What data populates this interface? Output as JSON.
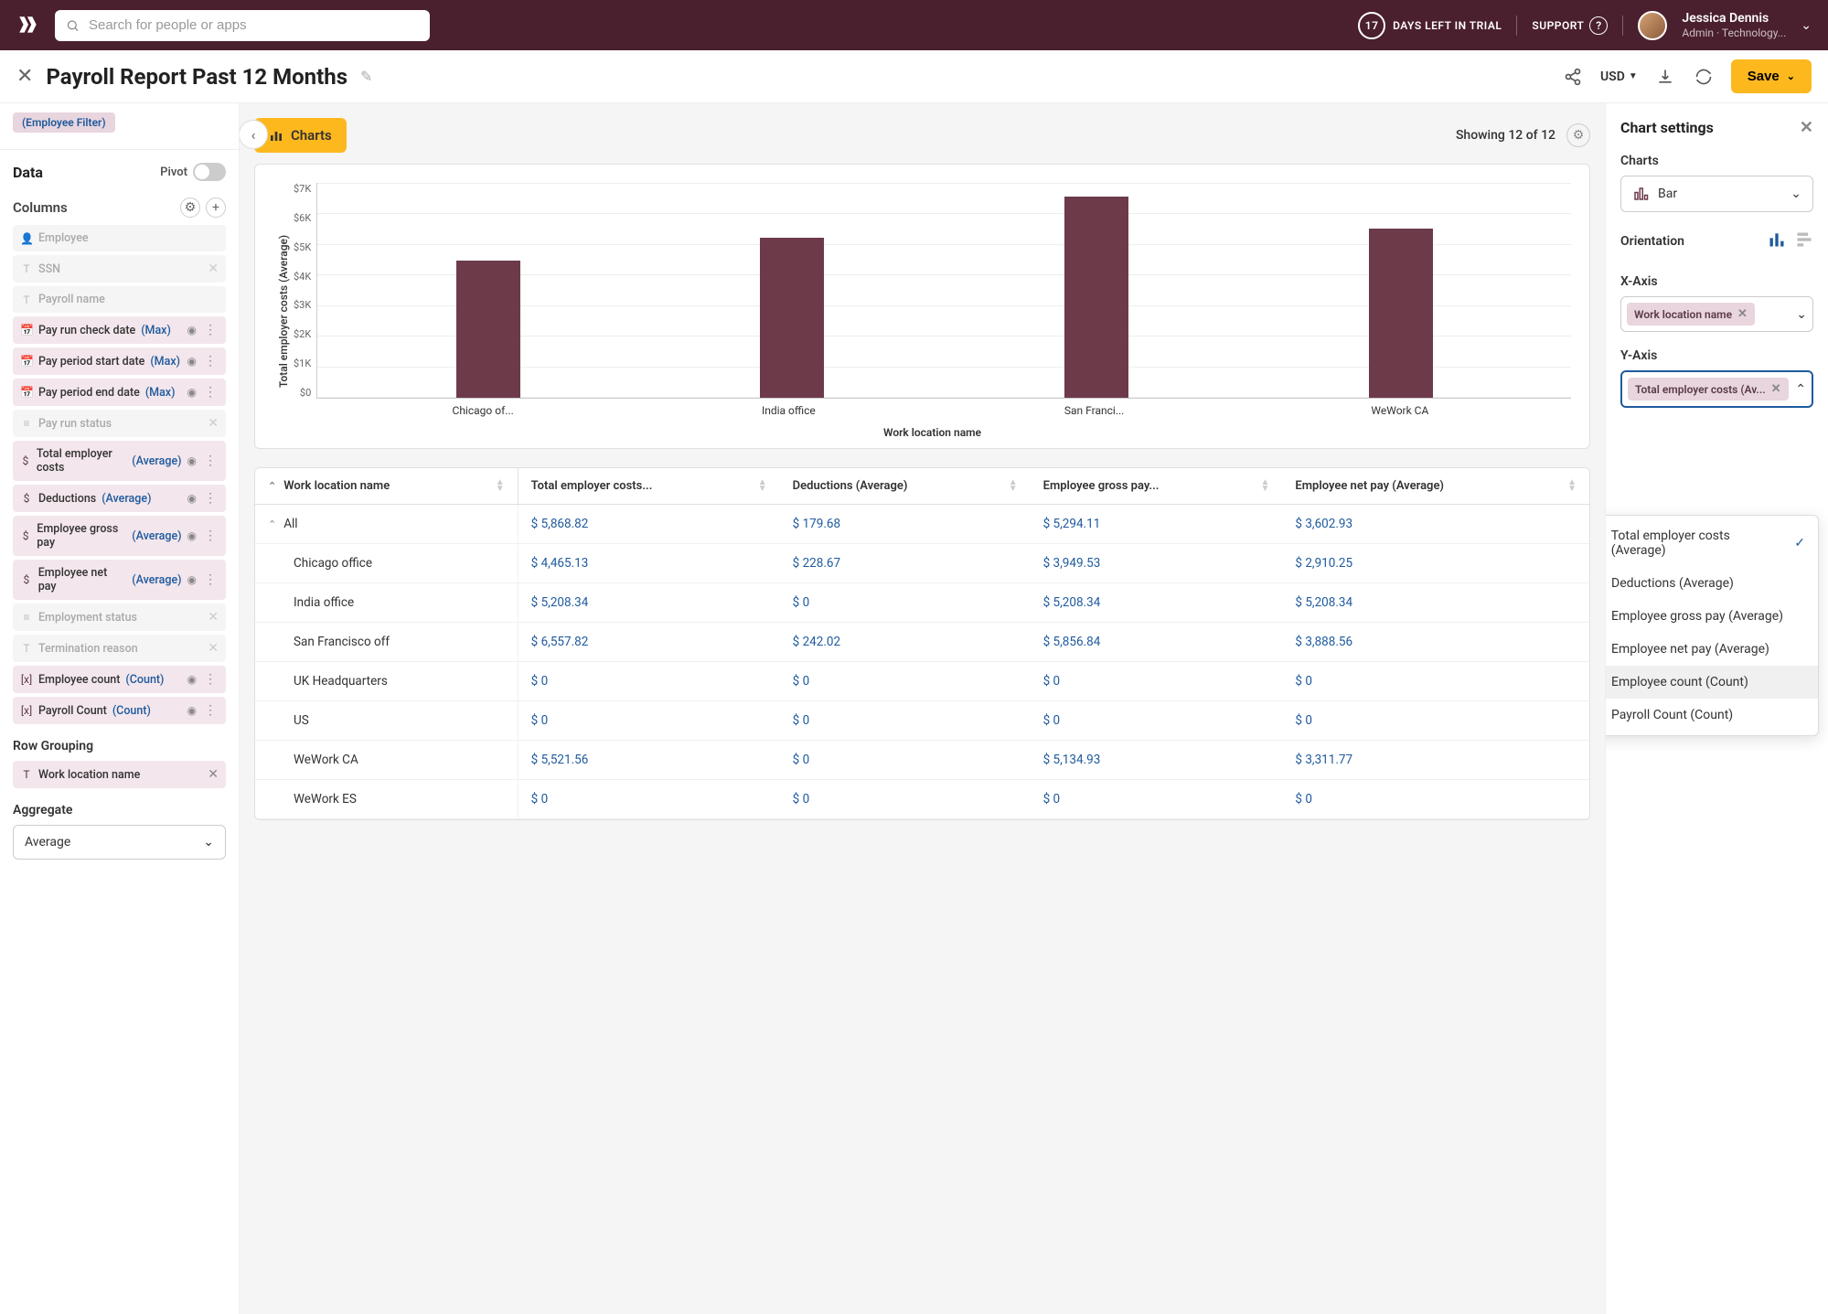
{
  "header": {
    "search_placeholder": "Search for people or apps",
    "trial_days": "17",
    "trial_text": "DAYS LEFT IN TRIAL",
    "support": "SUPPORT",
    "user_name": "Jessica Dennis",
    "user_role": "Admin · Technology..."
  },
  "titlebar": {
    "title": "Payroll Report Past 12 Months",
    "currency": "USD",
    "save": "Save"
  },
  "left_panel": {
    "filter_chip": "(Employee Filter)",
    "data_label": "Data",
    "pivot_label": "Pivot",
    "columns_label": "Columns",
    "row_grouping_label": "Row Grouping",
    "row_grouping_value": "Work location name",
    "aggregate_label": "Aggregate",
    "aggregate_value": "Average",
    "columns": [
      {
        "icon": "👤",
        "name": "Employee",
        "agg": "",
        "muted": true,
        "close": false
      },
      {
        "icon": "T",
        "name": "SSN",
        "agg": "",
        "muted": true,
        "close": true
      },
      {
        "icon": "T",
        "name": "Payroll name",
        "agg": "",
        "muted": true,
        "close": false
      },
      {
        "icon": "📅",
        "name": "Pay run check date",
        "agg": "(Max)",
        "muted": false,
        "menu": true
      },
      {
        "icon": "📅",
        "name": "Pay period start date",
        "agg": "(Max)",
        "muted": false,
        "menu": true
      },
      {
        "icon": "📅",
        "name": "Pay period end date",
        "agg": "(Max)",
        "muted": false,
        "menu": true
      },
      {
        "icon": "≡",
        "name": "Pay run status",
        "agg": "",
        "muted": true,
        "close": true
      },
      {
        "icon": "$",
        "name": "Total employer costs",
        "agg": "(Average)",
        "muted": false,
        "menu": true
      },
      {
        "icon": "$",
        "name": "Deductions",
        "agg": "(Average)",
        "muted": false,
        "menu": true
      },
      {
        "icon": "$",
        "name": "Employee gross pay",
        "agg": "(Average)",
        "muted": false,
        "menu": true
      },
      {
        "icon": "$",
        "name": "Employee net pay",
        "agg": "(Average)",
        "muted": false,
        "menu": true
      },
      {
        "icon": "≡",
        "name": "Employment status",
        "agg": "",
        "muted": true,
        "close": true
      },
      {
        "icon": "T",
        "name": "Termination reason",
        "agg": "",
        "muted": true,
        "close": true
      },
      {
        "icon": "[x]",
        "name": "Employee count",
        "agg": "(Count)",
        "muted": false,
        "menu": true
      },
      {
        "icon": "[x]",
        "name": "Payroll Count",
        "agg": "(Count)",
        "muted": false,
        "menu": true
      }
    ]
  },
  "center": {
    "charts_label": "Charts",
    "showing": "Showing 12 of 12",
    "table_headers": [
      "Work location name",
      "Total employer costs...",
      "Deductions (Average)",
      "Employee gross pay...",
      "Employee net pay (Average)"
    ],
    "table_rows": [
      {
        "name": "All",
        "c1": "$ 5,868.82",
        "c2": "$ 179.68",
        "c3": "$ 5,294.11",
        "c4": "$ 3,602.93",
        "expand": true
      },
      {
        "name": "Chicago office",
        "c1": "$ 4,465.13",
        "c2": "$ 228.67",
        "c3": "$ 3,949.53",
        "c4": "$ 2,910.25",
        "indent": true
      },
      {
        "name": "India office",
        "c1": "$ 5,208.34",
        "c2": "$ 0",
        "c3": "$ 5,208.34",
        "c4": "$ 5,208.34",
        "indent": true
      },
      {
        "name": "San Francisco off",
        "c1": "$ 6,557.82",
        "c2": "$ 242.02",
        "c3": "$ 5,856.84",
        "c4": "$ 3,888.56",
        "indent": true
      },
      {
        "name": "UK Headquarters",
        "c1": "$ 0",
        "c2": "$ 0",
        "c3": "$ 0",
        "c4": "$ 0",
        "indent": true
      },
      {
        "name": "US",
        "c1": "$ 0",
        "c2": "$ 0",
        "c3": "$ 0",
        "c4": "$ 0",
        "indent": true
      },
      {
        "name": "WeWork CA",
        "c1": "$ 5,521.56",
        "c2": "$ 0",
        "c3": "$ 5,134.93",
        "c4": "$ 3,311.77",
        "indent": true
      },
      {
        "name": "WeWork ES",
        "c1": "$ 0",
        "c2": "$ 0",
        "c3": "$ 0",
        "c4": "$ 0",
        "indent": true
      }
    ]
  },
  "chart_data": {
    "type": "bar",
    "title": "",
    "xlabel": "Work location name",
    "ylabel": "Total employer costs (Average)",
    "ylim": [
      0,
      7000
    ],
    "y_ticks": [
      "$7K",
      "$6K",
      "$5K",
      "$4K",
      "$3K",
      "$2K",
      "$1K",
      "$0"
    ],
    "categories": [
      "Chicago of...",
      "India office",
      "San Franci...",
      "WeWork CA"
    ],
    "values": [
      4465,
      5208,
      6558,
      5522
    ]
  },
  "right_panel": {
    "title": "Chart settings",
    "charts_label": "Charts",
    "chart_type": "Bar",
    "orientation_label": "Orientation",
    "x_axis_label": "X-Axis",
    "x_axis_chip": "Work location name",
    "y_axis_label": "Y-Axis",
    "y_axis_chip": "Total employer costs (Av...",
    "menu_items": [
      {
        "icon": "$",
        "label": "Total employer costs (Average)",
        "checked": true
      },
      {
        "icon": "$",
        "label": "Deductions (Average)"
      },
      {
        "icon": "$",
        "label": "Employee gross pay (Average)"
      },
      {
        "icon": "$",
        "label": "Employee net pay (Average)"
      },
      {
        "icon": "[x]",
        "label": "Employee count (Count)",
        "highlighted": true
      },
      {
        "icon": "[x]",
        "label": "Payroll Count (Count)"
      }
    ]
  }
}
